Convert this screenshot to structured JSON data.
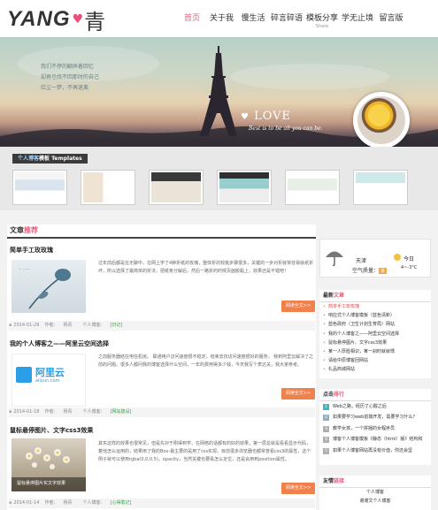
{
  "header": {
    "logo_latin": "YANG",
    "logo_cn": "青",
    "nav": [
      {
        "label": "首页",
        "active": true
      },
      {
        "label": "关于我"
      },
      {
        "label": "慢生活"
      },
      {
        "label": "碎言碎语"
      },
      {
        "label": "模板分享",
        "sub": "Share"
      },
      {
        "label": "学无止境"
      },
      {
        "label": "留言版"
      }
    ]
  },
  "banner": {
    "text_lines": [
      "我们不停的翻弄着回忆",
      "却再也找不回那时的自己",
      "红尘一梦，不再迷离"
    ],
    "love": "LOVE",
    "tagline": "Best is to be all you can be."
  },
  "templates": {
    "title_prefix": "个人博客",
    "title_highlight": "模板",
    "title_suffix": " Templates",
    "count": 6
  },
  "articles": {
    "heading_plain": "文章",
    "heading_pink": "推荐",
    "read_more": "阅读全文>>",
    "posts": [
      {
        "title": "简单手工玫玫瑰",
        "excerpt": "过年前后都是在无聊中，在网上学了4种折纸的玫瑰，整体折的较挑步骤很多，关键的一步对折就常容易就纸折坏，所以选择了最简单的折法，把纸条分解后，然后一路折的时候页面胶黏上，效果还是不错吧！",
        "date": "2014-01-29",
        "author_label": "作者：",
        "author": "杨青",
        "category_label": "个人博客：",
        "category": "[日记]"
      },
      {
        "title": "我的个人博客之——阿里云空间选择",
        "excerpt": "之前服务器结在电信机房。 联通用户访问速度很不稳定，结束去找访问速度很好的服务。 我到阿里云解决了之前的问题。很多人都问我的博客选择什么空间，一年的费用得多少钱，今天我写个表达关，我大家参考。",
        "date": "2014-01-18",
        "author_label": "作者：",
        "author": "杨青",
        "category_label": "个人博客：",
        "category": "[网站建设]",
        "thumb_text": "阿里云",
        "thumb_sub": "aliyun.com"
      },
      {
        "title": "鼠标悬停图片、文字css3效果",
        "excerpt": "其实这样的效果也很常见，但是先对于刚得到学，在网络的话都有的好的效果，第一层总就是看看显示代码，着他怎么运用的，结果用了我的Box-最主要的是用了css实现，目前很多浏览器也都常普看css3的属性，这个例子就可以使用rgba(0,0,0,5)，opacity，当然关键也要看怎么定位，还是会用到position属性。",
        "date": "2014-01-14",
        "author_label": "作者：",
        "author": "杨青",
        "category_label": "个人博客：",
        "category": "[心得笔记]",
        "thumb_caption": "鼠标悬停图片实文字效果"
      }
    ]
  },
  "weather": {
    "city": "天津",
    "air_label": "空气质量：",
    "air_value": "良",
    "today": "今日",
    "temp": "4~-3°C"
  },
  "latest": {
    "heading_plain": "最新",
    "heading_pink": "文章",
    "items": [
      "简单手工玫玫瑰",
      "响应式个人博客模板（蓝色清新）",
      "蓝色政府（卫生计划生育局）网站",
      "我的个人博客之——阿里云空间选择",
      "鼠标悬停图片、文字css3效果",
      "某一人厚脸相识，某一刹时就就悸",
      "请给中原博客回网站",
      "礼品商城网站"
    ]
  },
  "ranking": {
    "heading_plain": "点击",
    "heading_pink": "排行",
    "items": [
      "Web之路，经历了心酸之后",
      "如果要学习web前端开发，需要学习什么？",
      "教学女孩，一个拼捆的女程序员",
      "博客个人博客模板《静态（html）版》结构和",
      "如果个人博客网站再没有价值，你还会坚"
    ]
  },
  "links": {
    "heading_plain": "友情",
    "heading_pink": "链接",
    "items": [
      "个人博客",
      "谢谢文个人博客"
    ]
  }
}
